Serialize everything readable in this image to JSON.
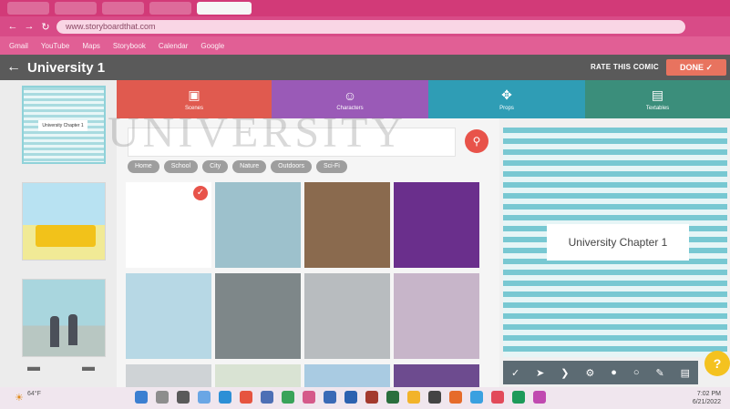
{
  "browser": {
    "url": "www.storyboardthat.com",
    "bookmarks": [
      "Gmail",
      "YouTube",
      "Maps",
      "Storybook",
      "Calendar",
      "Google"
    ]
  },
  "app": {
    "title": "University 1",
    "rate_label": "RATE THIS COMIC",
    "done_label": "DONE ✓"
  },
  "categories": [
    {
      "label": "Scenes",
      "icon": "image-icon",
      "color": "#e05a4f"
    },
    {
      "label": "Characters",
      "icon": "face-icon",
      "color": "#9a5ab7"
    },
    {
      "label": "Props",
      "icon": "cross-arrows-icon",
      "color": "#2f9db5"
    },
    {
      "label": "Textables",
      "icon": "speech-icon",
      "color": "#3b8e7b"
    }
  ],
  "search": {
    "placeholder": ""
  },
  "tags": [
    "Home",
    "School",
    "City",
    "Nature",
    "Outdoors",
    "Sci-Fi"
  ],
  "scenes": [
    {
      "name": "blank",
      "selected": true,
      "color": "#ffffff"
    },
    {
      "name": "school-building",
      "selected": false,
      "color": "#9dc1cc"
    },
    {
      "name": "classroom",
      "selected": false,
      "color": "#8a6a4e"
    },
    {
      "name": "stage",
      "selected": false,
      "color": "#6a2f8c"
    },
    {
      "name": "beach",
      "selected": false,
      "color": "#b7d8e5"
    },
    {
      "name": "pillars",
      "selected": false,
      "color": "#7e8789"
    },
    {
      "name": "doorway",
      "selected": false,
      "color": "#b8bcbf"
    },
    {
      "name": "cherry-tree",
      "selected": false,
      "color": "#c7b5c9"
    }
  ],
  "preview": {
    "chapter_label": "University Chapter 1",
    "toolbar": [
      "✓",
      "➤",
      "❯",
      "⚙",
      "●",
      "○",
      "✎",
      "▤"
    ],
    "help_label": "?"
  },
  "filmstrip": {
    "cell1_caption": "University Chapter 1"
  },
  "watermark": "UNIVERSITY",
  "taskbar": {
    "weather": "64°F",
    "time": "7:02 PM",
    "date": "6/21/2022"
  },
  "colors": {
    "tab_bar": "#d23a78",
    "header": "#5a5a5a",
    "done": "#e8735f",
    "help": "#f4c21f"
  }
}
